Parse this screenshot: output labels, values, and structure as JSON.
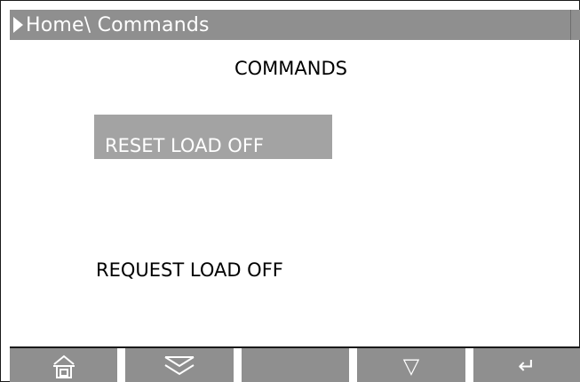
{
  "header": {
    "breadcrumb": "Home\\ Commands"
  },
  "screen": {
    "title": "COMMANDS"
  },
  "commands": [
    {
      "label": "RESET LOAD OFF",
      "selected": true
    },
    {
      "label": "REQUEST LOAD OFF",
      "selected": false
    }
  ],
  "softkeys": [
    {
      "icon": "home-icon"
    },
    {
      "icon": "double-chevron-down-icon"
    },
    {
      "icon": ""
    },
    {
      "icon": "triangle-down-icon",
      "glyph": "▽"
    },
    {
      "icon": "enter-icon",
      "glyph": "↵"
    }
  ],
  "colors": {
    "titlebar_bg": "#8f8f8f",
    "selected_bg": "#a3a3a3",
    "softkey_bg": "#8f8f8f"
  }
}
